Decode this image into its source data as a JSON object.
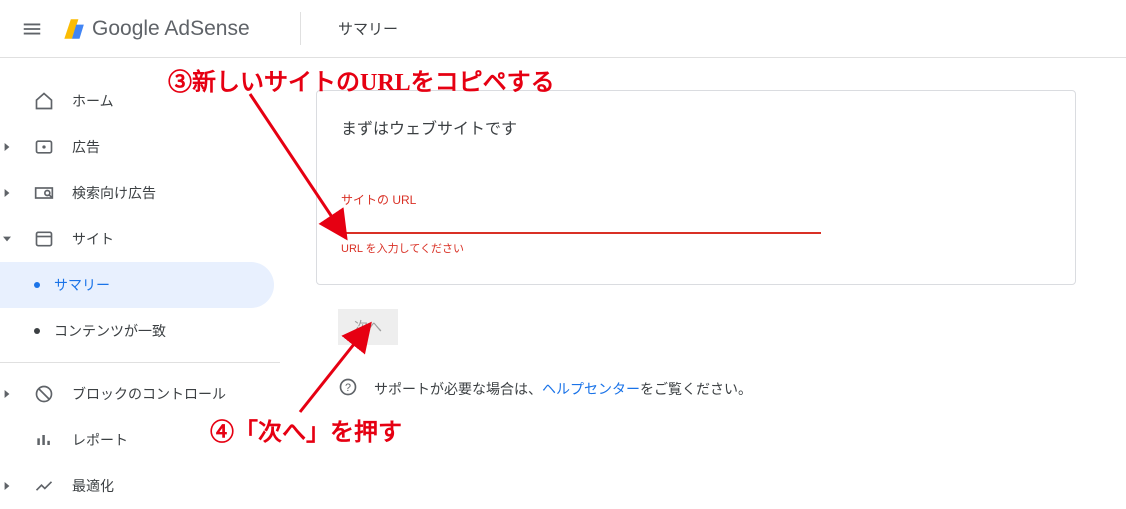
{
  "header": {
    "brand_part1": "Google",
    "brand_part2": " AdSense",
    "page_title": "サマリー"
  },
  "sidebar": {
    "items": [
      {
        "label": "ホーム",
        "expandable": false
      },
      {
        "label": "広告",
        "expandable": true
      },
      {
        "label": "検索向け広告",
        "expandable": true
      },
      {
        "label": "サイト",
        "expandable": true,
        "expanded": true
      },
      {
        "label": "ブロックのコントロール",
        "expandable": true
      },
      {
        "label": "レポート"
      },
      {
        "label": "最適化",
        "expandable": true
      }
    ],
    "sub_items": {
      "sites": [
        {
          "label": "サマリー",
          "active": true
        },
        {
          "label": "コンテンツが一致",
          "active": false
        }
      ]
    }
  },
  "card": {
    "title": "まずはウェブサイトです",
    "url_field": {
      "label": "サイトの URL",
      "value": "",
      "helper": "URL を入力してください"
    }
  },
  "next_button": {
    "label": "次へ"
  },
  "support": {
    "prefix": "サポートが必要な場合は、",
    "link": "ヘルプセンター",
    "suffix": "をご覧ください。"
  },
  "annotations": {
    "step3": "③新しいサイトのURLをコピペする",
    "step4": "④「次へ」を押す"
  }
}
